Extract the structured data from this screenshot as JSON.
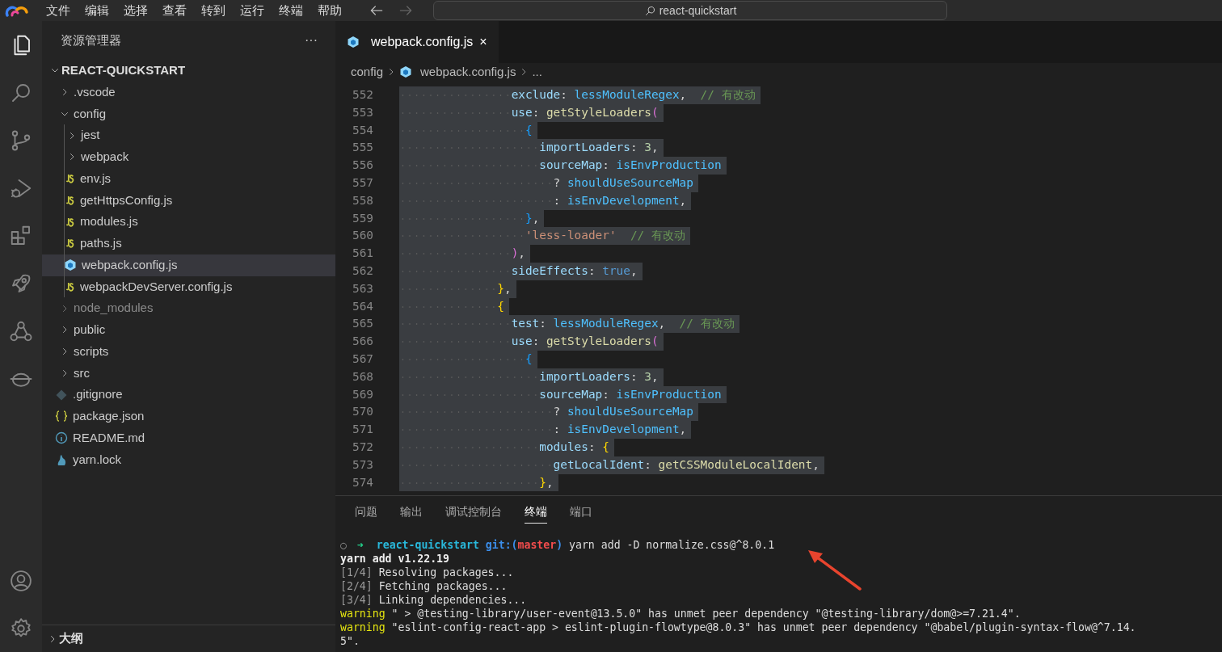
{
  "menu": [
    "文件",
    "编辑",
    "选择",
    "查看",
    "转到",
    "运行",
    "终端",
    "帮助"
  ],
  "command_center": {
    "text": "react-quickstart"
  },
  "activity_bar": [
    {
      "kind": "files",
      "selected": true
    },
    {
      "kind": "search",
      "selected": false
    },
    {
      "kind": "source-control",
      "selected": false
    },
    {
      "kind": "run-debug",
      "selected": false
    },
    {
      "kind": "extensions",
      "selected": false
    },
    {
      "kind": "rocket",
      "selected": false
    },
    {
      "kind": "share",
      "selected": false
    },
    {
      "kind": "mascot",
      "selected": false
    }
  ],
  "activity_bar_bottom": [
    {
      "kind": "account"
    },
    {
      "kind": "settings"
    }
  ],
  "sidebar": {
    "title": "资源管理器",
    "more": "···",
    "root": {
      "label": "REACT-QUICKSTART",
      "expanded": true
    },
    "items": [
      {
        "label": ".vscode",
        "kind": "folder",
        "expanded": false,
        "selected": false,
        "dimmed": false
      },
      {
        "label": "config",
        "kind": "folder",
        "expanded": true,
        "selected": false,
        "dimmed": false,
        "children": [
          {
            "label": "jest",
            "kind": "folder",
            "expanded": false,
            "selected": false,
            "dimmed": false
          },
          {
            "label": "webpack",
            "kind": "folder",
            "expanded": false,
            "selected": false,
            "dimmed": false
          },
          {
            "label": "env.js",
            "kind": "js",
            "selected": false,
            "dimmed": false
          },
          {
            "label": "getHttpsConfig.js",
            "kind": "js",
            "selected": false,
            "dimmed": false
          },
          {
            "label": "modules.js",
            "kind": "js",
            "selected": false,
            "dimmed": false
          },
          {
            "label": "paths.js",
            "kind": "js",
            "selected": false,
            "dimmed": false
          },
          {
            "label": "webpack.config.js",
            "kind": "webpack",
            "selected": true,
            "dimmed": false
          },
          {
            "label": "webpackDevServer.config.js",
            "kind": "js",
            "selected": false,
            "dimmed": false
          }
        ]
      },
      {
        "label": "node_modules",
        "kind": "folder",
        "expanded": false,
        "selected": false,
        "dimmed": true
      },
      {
        "label": "public",
        "kind": "folder",
        "expanded": false,
        "selected": false,
        "dimmed": false
      },
      {
        "label": "scripts",
        "kind": "folder",
        "expanded": false,
        "selected": false,
        "dimmed": false
      },
      {
        "label": "src",
        "kind": "folder",
        "expanded": false,
        "selected": false,
        "dimmed": false
      },
      {
        "label": ".gitignore",
        "kind": "git",
        "selected": false,
        "dimmed": false
      },
      {
        "label": "package.json",
        "kind": "json",
        "selected": false,
        "dimmed": false
      },
      {
        "label": "README.md",
        "kind": "info",
        "selected": false,
        "dimmed": false
      },
      {
        "label": "yarn.lock",
        "kind": "yarn",
        "selected": false,
        "dimmed": false
      }
    ],
    "sections": [
      {
        "label": "大纲",
        "expanded": false
      }
    ]
  },
  "editor": {
    "tabs": [
      {
        "label": "webpack.config.js",
        "close": "×",
        "selected": true
      }
    ],
    "breadcrumb": [
      {
        "text": "config",
        "kind": "folder"
      },
      {
        "text": "webpack.config.js",
        "kind": "webpack"
      },
      {
        "text": "...",
        "kind": "more"
      }
    ],
    "lines": [
      {
        "num": "552",
        "selected": true,
        "tokens": [
          {
            "kind": "key",
            "text": "                exclude"
          },
          {
            "kind": "punct",
            "text": ": "
          },
          {
            "kind": "ident",
            "text": "lessModuleRegex"
          },
          {
            "kind": "punct",
            "text": ",  "
          },
          {
            "kind": "comment",
            "text": "// 有改动"
          }
        ]
      },
      {
        "num": "553",
        "selected": true,
        "tokens": [
          {
            "kind": "key",
            "text": "                use"
          },
          {
            "kind": "punct",
            "text": ": "
          },
          {
            "kind": "fn",
            "text": "getStyleLoaders"
          },
          {
            "kind": "bracket2",
            "text": "("
          }
        ]
      },
      {
        "num": "554",
        "selected": true,
        "tokens": [
          {
            "kind": "bracket3",
            "text": "                  {"
          }
        ]
      },
      {
        "num": "555",
        "selected": true,
        "tokens": [
          {
            "kind": "key",
            "text": "                    importLoaders"
          },
          {
            "kind": "punct",
            "text": ": "
          },
          {
            "kind": "num",
            "text": "3"
          },
          {
            "kind": "punct",
            "text": ","
          }
        ]
      },
      {
        "num": "556",
        "selected": true,
        "tokens": [
          {
            "kind": "key",
            "text": "                    sourceMap"
          },
          {
            "kind": "punct",
            "text": ": "
          },
          {
            "kind": "ident",
            "text": "isEnvProduction"
          }
        ]
      },
      {
        "num": "557",
        "selected": true,
        "tokens": [
          {
            "kind": "punct",
            "text": "                      ? "
          },
          {
            "kind": "ident",
            "text": "shouldUseSourceMap"
          }
        ]
      },
      {
        "num": "558",
        "selected": true,
        "tokens": [
          {
            "kind": "punct",
            "text": "                      : "
          },
          {
            "kind": "ident",
            "text": "isEnvDevelopment"
          },
          {
            "kind": "punct",
            "text": ","
          }
        ]
      },
      {
        "num": "559",
        "selected": true,
        "tokens": [
          {
            "kind": "bracket3",
            "text": "                  }"
          },
          {
            "kind": "punct",
            "text": ","
          }
        ]
      },
      {
        "num": "560",
        "selected": true,
        "tokens": [
          {
            "kind": "string",
            "text": "                  'less-loader'"
          },
          {
            "kind": "comment",
            "text": "  // 有改动"
          }
        ]
      },
      {
        "num": "561",
        "selected": true,
        "tokens": [
          {
            "kind": "bracket2",
            "text": "                )"
          },
          {
            "kind": "punct",
            "text": ","
          }
        ]
      },
      {
        "num": "562",
        "selected": true,
        "tokens": [
          {
            "kind": "key",
            "text": "                sideEffects"
          },
          {
            "kind": "punct",
            "text": ": "
          },
          {
            "kind": "bool",
            "text": "true"
          },
          {
            "kind": "punct",
            "text": ","
          }
        ]
      },
      {
        "num": "563",
        "selected": true,
        "tokens": [
          {
            "kind": "bracket1",
            "text": "              }"
          },
          {
            "kind": "punct",
            "text": ","
          }
        ]
      },
      {
        "num": "564",
        "selected": true,
        "tokens": [
          {
            "kind": "bracket1",
            "text": "              {"
          }
        ]
      },
      {
        "num": "565",
        "selected": true,
        "tokens": [
          {
            "kind": "key",
            "text": "                test"
          },
          {
            "kind": "punct",
            "text": ": "
          },
          {
            "kind": "ident",
            "text": "lessModuleRegex"
          },
          {
            "kind": "punct",
            "text": ",  "
          },
          {
            "kind": "comment",
            "text": "// 有改动"
          }
        ]
      },
      {
        "num": "566",
        "selected": true,
        "tokens": [
          {
            "kind": "key",
            "text": "                use"
          },
          {
            "kind": "punct",
            "text": ": "
          },
          {
            "kind": "fn",
            "text": "getStyleLoaders"
          },
          {
            "kind": "bracket2",
            "text": "("
          }
        ]
      },
      {
        "num": "567",
        "selected": true,
        "tokens": [
          {
            "kind": "bracket3",
            "text": "                  {"
          }
        ]
      },
      {
        "num": "568",
        "selected": true,
        "tokens": [
          {
            "kind": "key",
            "text": "                    importLoaders"
          },
          {
            "kind": "punct",
            "text": ": "
          },
          {
            "kind": "num",
            "text": "3"
          },
          {
            "kind": "punct",
            "text": ","
          }
        ]
      },
      {
        "num": "569",
        "selected": true,
        "tokens": [
          {
            "kind": "key",
            "text": "                    sourceMap"
          },
          {
            "kind": "punct",
            "text": ": "
          },
          {
            "kind": "ident",
            "text": "isEnvProduction"
          }
        ]
      },
      {
        "num": "570",
        "selected": true,
        "tokens": [
          {
            "kind": "punct",
            "text": "                      ? "
          },
          {
            "kind": "ident",
            "text": "shouldUseSourceMap"
          }
        ]
      },
      {
        "num": "571",
        "selected": true,
        "tokens": [
          {
            "kind": "punct",
            "text": "                      : "
          },
          {
            "kind": "ident",
            "text": "isEnvDevelopment"
          },
          {
            "kind": "punct",
            "text": ","
          }
        ]
      },
      {
        "num": "572",
        "selected": true,
        "tokens": [
          {
            "kind": "key",
            "text": "                    modules"
          },
          {
            "kind": "punct",
            "text": ": "
          },
          {
            "kind": "bracket1",
            "text": "{"
          }
        ]
      },
      {
        "num": "573",
        "selected": true,
        "tokens": [
          {
            "kind": "key",
            "text": "                      getLocalIdent"
          },
          {
            "kind": "punct",
            "text": ": "
          },
          {
            "kind": "fn",
            "text": "getCSSModuleLocalIdent"
          },
          {
            "kind": "punct",
            "text": ","
          }
        ]
      },
      {
        "num": "574",
        "selected": true,
        "tokens": [
          {
            "kind": "bracket1",
            "text": "                    }"
          },
          {
            "kind": "punct",
            "text": ","
          }
        ]
      }
    ]
  },
  "panel": {
    "tabs": [
      {
        "label": "问题",
        "selected": false
      },
      {
        "label": "输出",
        "selected": false
      },
      {
        "label": "调试控制台",
        "selected": false
      },
      {
        "label": "终端",
        "selected": true
      },
      {
        "label": "端口",
        "selected": false
      }
    ],
    "terminal": [
      {
        "segments": [
          {
            "kind": "gutter",
            "text": "○"
          },
          {
            "kind": "arrow",
            "text": "➜"
          },
          {
            "kind": "dir",
            "text": "  react-quickstart"
          },
          {
            "kind": "git",
            "text": " git:("
          },
          {
            "kind": "branch",
            "text": "master"
          },
          {
            "kind": "git",
            "text": ")"
          },
          {
            "kind": "plain",
            "text": " yarn add -D normalize.css@^8.0.1"
          }
        ]
      },
      {
        "segments": [
          {
            "kind": "bold",
            "text": "yarn add v1.22.19"
          }
        ]
      },
      {
        "segments": [
          {
            "kind": "dim",
            "text": "[1/4]"
          },
          {
            "kind": "plain",
            "text": " Resolving packages..."
          }
        ]
      },
      {
        "segments": [
          {
            "kind": "dim",
            "text": "[2/4]"
          },
          {
            "kind": "plain",
            "text": " Fetching packages..."
          }
        ]
      },
      {
        "segments": [
          {
            "kind": "dim",
            "text": "[3/4]"
          },
          {
            "kind": "plain",
            "text": " Linking dependencies..."
          }
        ]
      },
      {
        "segments": [
          {
            "kind": "warning",
            "text": "warning"
          },
          {
            "kind": "plain",
            "text": " \" > @testing-library/user-event@13.5.0\" has unmet peer dependency \"@testing-library/dom@>=7.21.4\"."
          }
        ]
      },
      {
        "segments": [
          {
            "kind": "warning",
            "text": "warning"
          },
          {
            "kind": "plain",
            "text": " \"eslint-config-react-app > eslint-plugin-flowtype@8.0.3\" has unmet peer dependency \"@babel/plugin-syntax-flow@^7.14."
          }
        ]
      },
      {
        "segments": [
          {
            "kind": "plain",
            "text": "5\"."
          }
        ]
      }
    ]
  }
}
